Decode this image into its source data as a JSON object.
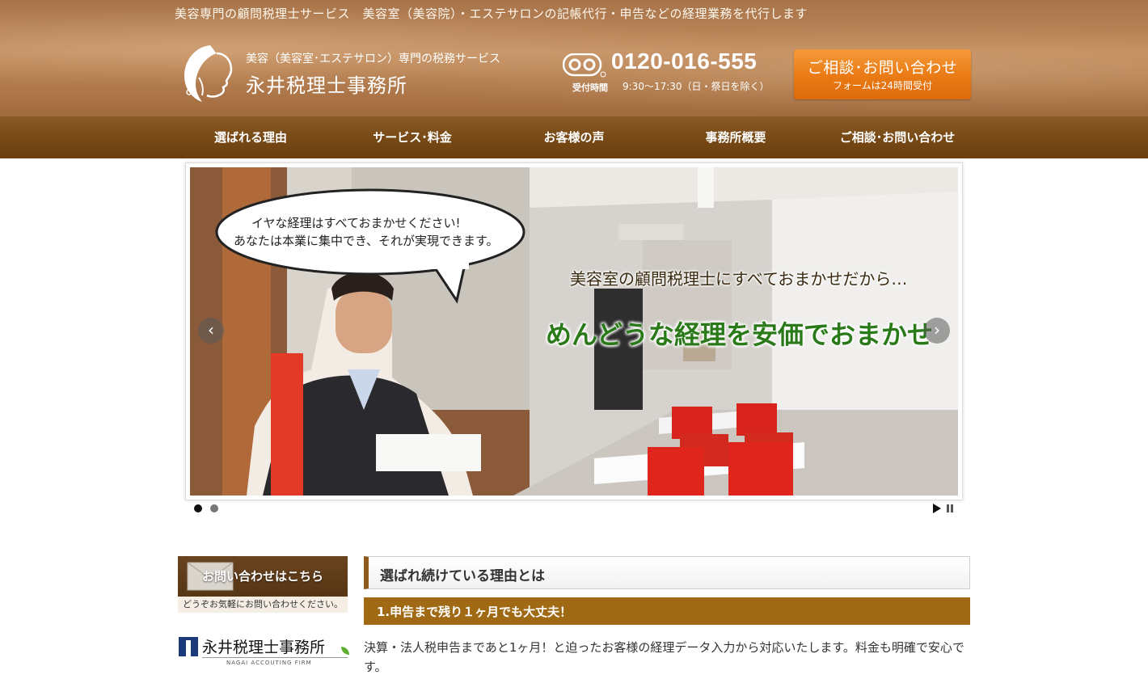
{
  "header": {
    "tagline": "美容専門の顧問税理士サービス　美容室（美容院）・エステサロンの記帳代行・申告などの経理業務を代行します",
    "logo_subtitle": "美容（美容室･エステサロン）専門の税務サービス",
    "logo_title": "永井税理士事務所",
    "tel_number": "0120-016-555",
    "tel_hours_label": "受付時間",
    "tel_hours": "9:30〜17:30（日・祭日を除く）",
    "contact_main": "ご相談･お問い合わせ",
    "contact_sub": "フォームは24時間受付",
    "accent_color": "#ea7a14"
  },
  "nav": {
    "items": [
      {
        "label": "選ばれる理由"
      },
      {
        "label": "サービス･料金"
      },
      {
        "label": "お客様の声"
      },
      {
        "label": "事務所概要"
      },
      {
        "label": "ご相談･お問い合わせ"
      }
    ]
  },
  "slider": {
    "bubble_line1": "イヤな経理はすべておまかせください!",
    "bubble_line2": "あなたは本業に集中でき、それが実現できます。",
    "caption1": "美容室の顧問税理士にすべておまかせだから…",
    "caption2": "めんどうな経理を安価でおまかせ",
    "prev_icon": "‹",
    "next_icon": "›",
    "slide_count": 2,
    "active_slide": 1
  },
  "sidebar": {
    "banner_title": "お問い合わせはこちら",
    "banner_note": "どうぞお気軽にお問い合わせください。",
    "logo_name": "永井税理士事務所",
    "logo_en": "NAGAI ACCOUTING FIRM"
  },
  "main": {
    "section_title": "選ばれ続けている理由とは",
    "point_title": "1.申告まで残り１ヶ月でも大丈夫！",
    "point_text": "決算・法人税申告まであと1ヶ月！と迫ったお客様の経理データ入力から対応いたします。料金も明確で安心です。"
  }
}
